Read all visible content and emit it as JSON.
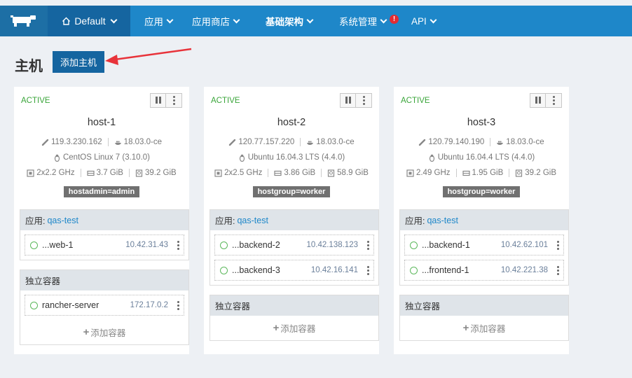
{
  "nav": {
    "environment": "Default",
    "items": [
      {
        "label": "应用",
        "bold": false
      },
      {
        "label": "应用商店",
        "bold": false
      },
      {
        "label": "基础架构",
        "bold": true
      },
      {
        "label": "系统管理",
        "bold": false,
        "alert": "!"
      },
      {
        "label": "API",
        "bold": false
      }
    ]
  },
  "page": {
    "title": "主机",
    "add_host_label": "添加主机"
  },
  "hosts": [
    {
      "state": "ACTIVE",
      "name": "host-1",
      "ip": "119.3.230.162",
      "docker": "18.03.0-ce",
      "os": "CentOS Linux 7 (3.10.0)",
      "cpu": "2x2.2 GHz",
      "ram": "3.7 GiB",
      "disk": "39.2 GiB",
      "label": "hostadmin=admin",
      "app_group": {
        "prefix": "应用:",
        "stack": "qas-test",
        "containers": [
          {
            "name": "...web-1",
            "ip": "10.42.31.43"
          }
        ]
      },
      "standalone": {
        "title": "独立容器",
        "containers": [
          {
            "name": "rancher-server",
            "ip": "172.17.0.2"
          }
        ],
        "add_label": "添加容器"
      }
    },
    {
      "state": "ACTIVE",
      "name": "host-2",
      "ip": "120.77.157.220",
      "docker": "18.03.0-ce",
      "os": "Ubuntu 16.04.3 LTS (4.4.0)",
      "cpu": "2x2.5 GHz",
      "ram": "3.86 GiB",
      "disk": "58.9 GiB",
      "label": "hostgroup=worker",
      "app_group": {
        "prefix": "应用:",
        "stack": "qas-test",
        "containers": [
          {
            "name": "...backend-2",
            "ip": "10.42.138.123"
          },
          {
            "name": "...backend-3",
            "ip": "10.42.16.141"
          }
        ]
      },
      "standalone": {
        "title": "独立容器",
        "containers": [],
        "add_label": "添加容器"
      }
    },
    {
      "state": "ACTIVE",
      "name": "host-3",
      "ip": "120.79.140.190",
      "docker": "18.03.0-ce",
      "os": "Ubuntu 16.04.4 LTS (4.4.0)",
      "cpu": "2.49 GHz",
      "ram": "1.95 GiB",
      "disk": "39.2 GiB",
      "label": "hostgroup=worker",
      "app_group": {
        "prefix": "应用:",
        "stack": "qas-test",
        "containers": [
          {
            "name": "...backend-1",
            "ip": "10.42.62.101"
          },
          {
            "name": "...frontend-1",
            "ip": "10.42.221.38"
          }
        ]
      },
      "standalone": {
        "title": "独立容器",
        "containers": [],
        "add_label": "添加容器"
      }
    }
  ],
  "colors": {
    "nav_bg": "#1e87c9",
    "nav_dark": "#1565a0",
    "active": "#3aa53a",
    "annotation_arrow": "#e8333a"
  }
}
